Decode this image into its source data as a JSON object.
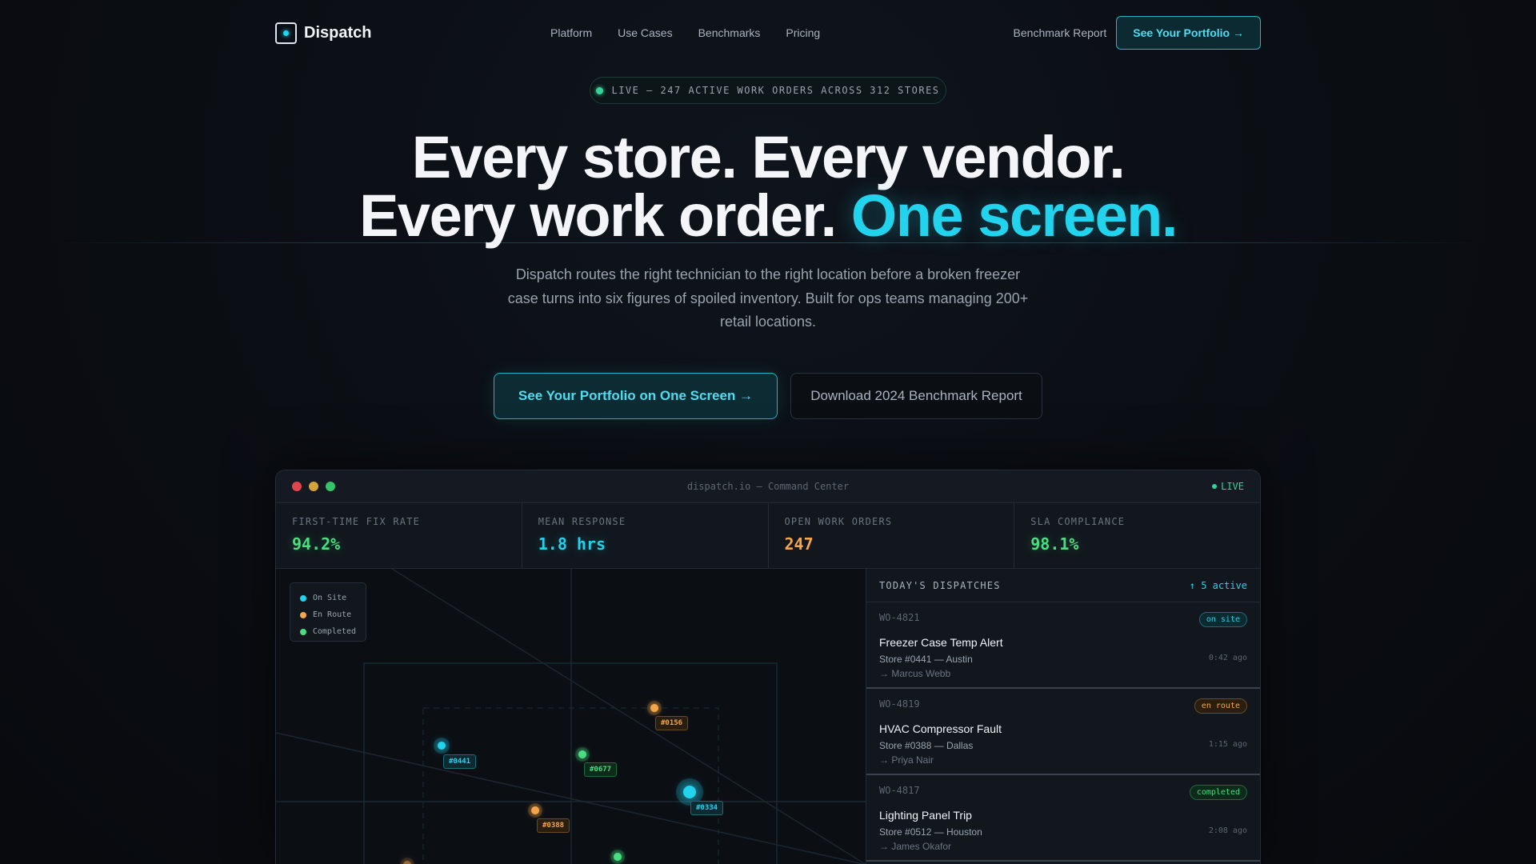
{
  "brand": {
    "name": "Dispatch"
  },
  "nav": {
    "links": [
      "Platform",
      "Use Cases",
      "Benchmarks",
      "Pricing"
    ],
    "report_link": "Benchmark Report",
    "cta": "See Your Portfolio →"
  },
  "hero": {
    "live_badge": "LIVE — 247 ACTIVE WORK ORDERS ACROSS 312 STORES",
    "headline_1": "Every store. Every vendor.",
    "headline_2a": "Every work order.",
    "headline_2b": "One screen.",
    "subtitle": "Dispatch routes the right technician to the right location before a broken freezer case turns into six figures of spoiled inventory. Built for ops teams managing 200+ retail locations.",
    "primary_cta": "See Your Portfolio on One Screen →",
    "secondary_cta": "Download 2024 Benchmark Report"
  },
  "app": {
    "window_title": "dispatch.io — Command Center",
    "live_label": "LIVE",
    "kpis": [
      {
        "label": "FIRST-TIME FIX RATE",
        "value": "94.2%"
      },
      {
        "label": "MEAN RESPONSE",
        "value": "1.8 hrs"
      },
      {
        "label": "OPEN WORK ORDERS",
        "value": "247"
      },
      {
        "label": "SLA COMPLIANCE",
        "value": "98.1%"
      }
    ],
    "legend": [
      "On Site",
      "En Route",
      "Completed"
    ],
    "pins": [
      "#0441",
      "#0156",
      "#0677",
      "#0334",
      "#0388"
    ],
    "dispatches": {
      "title": "TODAY'S DISPATCHES",
      "active": "↑ 5 active",
      "items": [
        {
          "id": "WO-4821",
          "status": "on site",
          "title": "Freezer Case Temp Alert",
          "store": "Store #0441 — Austin",
          "tech": "→ Marcus Webb",
          "time": "0:42 ago"
        },
        {
          "id": "WO-4819",
          "status": "en route",
          "title": "HVAC Compressor Fault",
          "store": "Store #0388 — Dallas",
          "tech": "→ Priya Nair",
          "time": "1:15 ago"
        },
        {
          "id": "WO-4817",
          "status": "completed",
          "title": "Lighting Panel Trip",
          "store": "Store #0512 — Houston",
          "tech": "→ James Okafor",
          "time": "2:08 ago"
        }
      ]
    }
  },
  "colors": {
    "accent": "#22d3ee",
    "green": "#4ade80",
    "orange": "#f5a54a",
    "background": "#0a0d12"
  }
}
